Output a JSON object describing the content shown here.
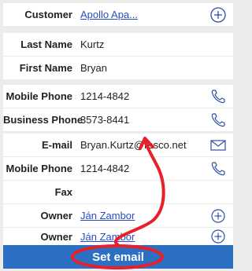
{
  "fields": {
    "customer": {
      "label": "Customer",
      "value": "Apollo Apa..."
    },
    "last_name": {
      "label": "Last Name",
      "value": "Kurtz"
    },
    "first_name": {
      "label": "First Name",
      "value": "Bryan"
    },
    "mobile_phone_1": {
      "label": "Mobile Phone",
      "value": "1214-4842"
    },
    "business_phone": {
      "label": "Business Phone",
      "value": "3573-8441"
    },
    "email": {
      "label": "E-mail",
      "value": "Bryan.Kurtz@resco.net"
    },
    "mobile_phone_2": {
      "label": "Mobile Phone",
      "value": "1214-4842"
    },
    "fax": {
      "label": "Fax",
      "value": ""
    },
    "owner_1": {
      "label": "Owner",
      "value": "Ján Zambor"
    },
    "owner_2": {
      "label": "Owner",
      "value": "Ján Zambor"
    }
  },
  "action_bar": {
    "label": "Set email"
  },
  "colors": {
    "accent_blue": "#2c70c4",
    "link_blue": "#2a4cc4",
    "annotation_red": "#e8202a",
    "background": "#ececec"
  },
  "icons": {
    "customer": "plus-circle-icon",
    "mobile_phone_1": "phone-icon",
    "business_phone": "phone-icon",
    "email": "envelope-icon",
    "mobile_phone_2": "phone-icon",
    "owner_1": "plus-circle-icon",
    "owner_2": "plus-circle-icon"
  }
}
